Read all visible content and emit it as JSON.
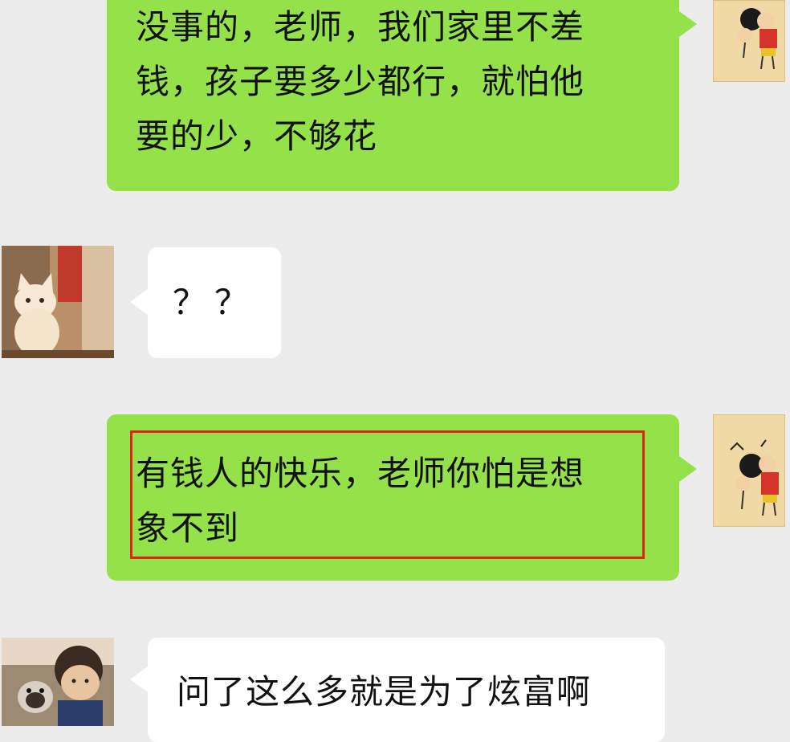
{
  "messages": [
    {
      "sender": "self",
      "text_lines": [
        "没事的，老师，我们家里不差",
        "钱，孩子要多少都行，就怕他",
        "要的少，不够花"
      ]
    },
    {
      "sender": "teacher",
      "text": "？？"
    },
    {
      "sender": "self",
      "text_lines": [
        "有钱人的快乐，老师你怕是想",
        "象不到"
      ],
      "highlighted": true,
      "highlight_color": "#e2231a"
    },
    {
      "sender": "teacher",
      "text": "问了这么多就是为了炫富啊"
    }
  ],
  "colors": {
    "self_bubble": "#95e14a",
    "other_bubble": "#ffffff",
    "background": "#ececec",
    "highlight": "#e2231a"
  },
  "avatars": {
    "self": "crayon-shinchan-avatar",
    "teacher_1": "white-kitten-avatar",
    "teacher_2": "child-with-dog-avatar"
  }
}
